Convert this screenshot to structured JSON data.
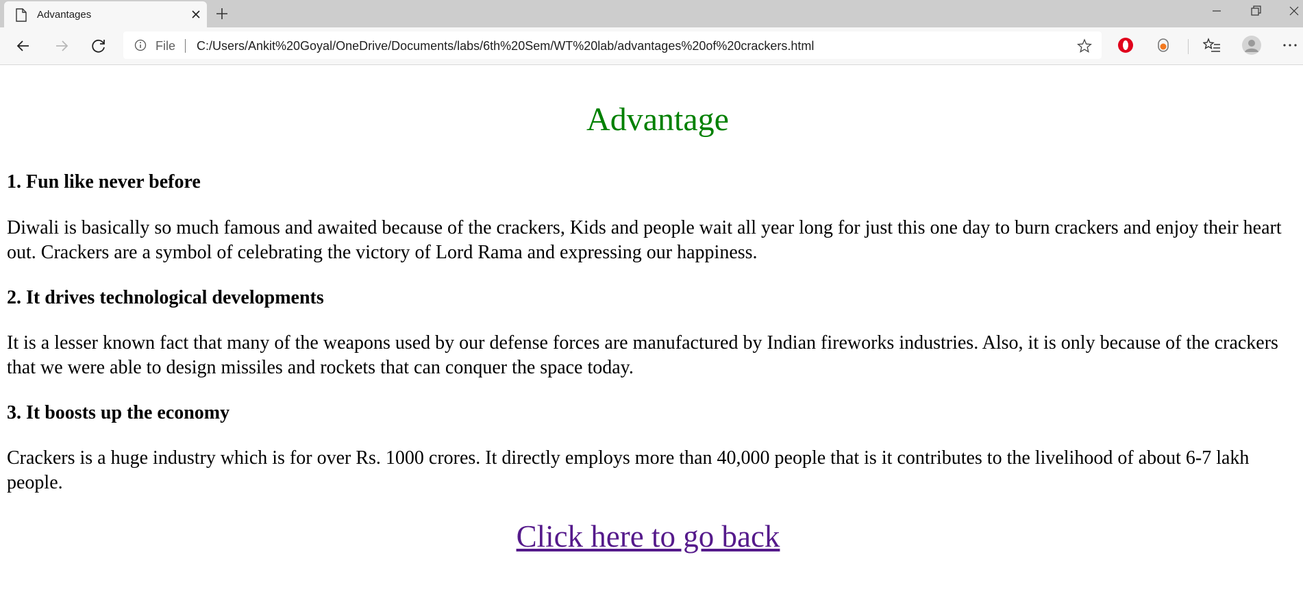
{
  "browser": {
    "tab": {
      "title": "Advantages"
    },
    "address": {
      "file_label": "File",
      "url": "C:/Users/Ankit%20Goyal/OneDrive/Documents/labs/6th%20Sem/WT%20lab/advantages%20of%20crackers.html"
    },
    "icons": [
      "document-icon",
      "close-icon",
      "plus-icon",
      "minimize-icon",
      "restore-icon",
      "back-arrow-icon",
      "forward-arrow-icon",
      "refresh-icon",
      "info-icon",
      "star-icon",
      "opera-extension-icon",
      "honey-extension-icon",
      "favorites-icon",
      "profile-icon",
      "more-icon"
    ]
  },
  "page": {
    "title": "Advantage",
    "title_color": "#008000",
    "link_color": "#551a8b",
    "sections": [
      {
        "heading": "1. Fun like never before",
        "body": "Diwali is basically so much famous and awaited because of the crackers, Kids and people wait all year long for just this one day to burn crackers and enjoy their heart out. Crackers are a symbol of celebrating the victory of Lord Rama and expressing our happiness."
      },
      {
        "heading": "2. It drives technological developments",
        "body": "It is a lesser known fact that many of the weapons used by our defense forces are manufactured by Indian fireworks industries. Also, it is only because of the crackers that we were able to design missiles and rockets that can conquer the space today."
      },
      {
        "heading": "3. It boosts up the economy",
        "body": "Crackers is a huge industry which is for over Rs. 1000 crores. It directly employs more than 40,000 people that is it contributes to the livelihood of about 6-7 lakh people."
      }
    ],
    "back_link": "Click here to go back"
  }
}
